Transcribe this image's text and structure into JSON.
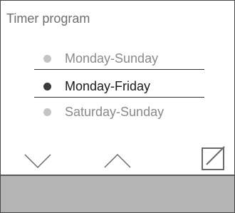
{
  "screen": {
    "title": "Timer program"
  },
  "options": [
    {
      "label": "Monday-Sunday",
      "selected": false
    },
    {
      "label": "Monday-Friday",
      "selected": true
    },
    {
      "label": "Saturday-Sunday",
      "selected": false
    }
  ],
  "controls": {
    "down_icon": "chevron-down-icon",
    "up_icon": "chevron-up-icon",
    "edit_icon": "edit-icon"
  },
  "colors": {
    "selected_dot": "#3a3a3a",
    "unselected_dot": "#c4c4c4",
    "footer_bar": "#b4b4b4"
  }
}
